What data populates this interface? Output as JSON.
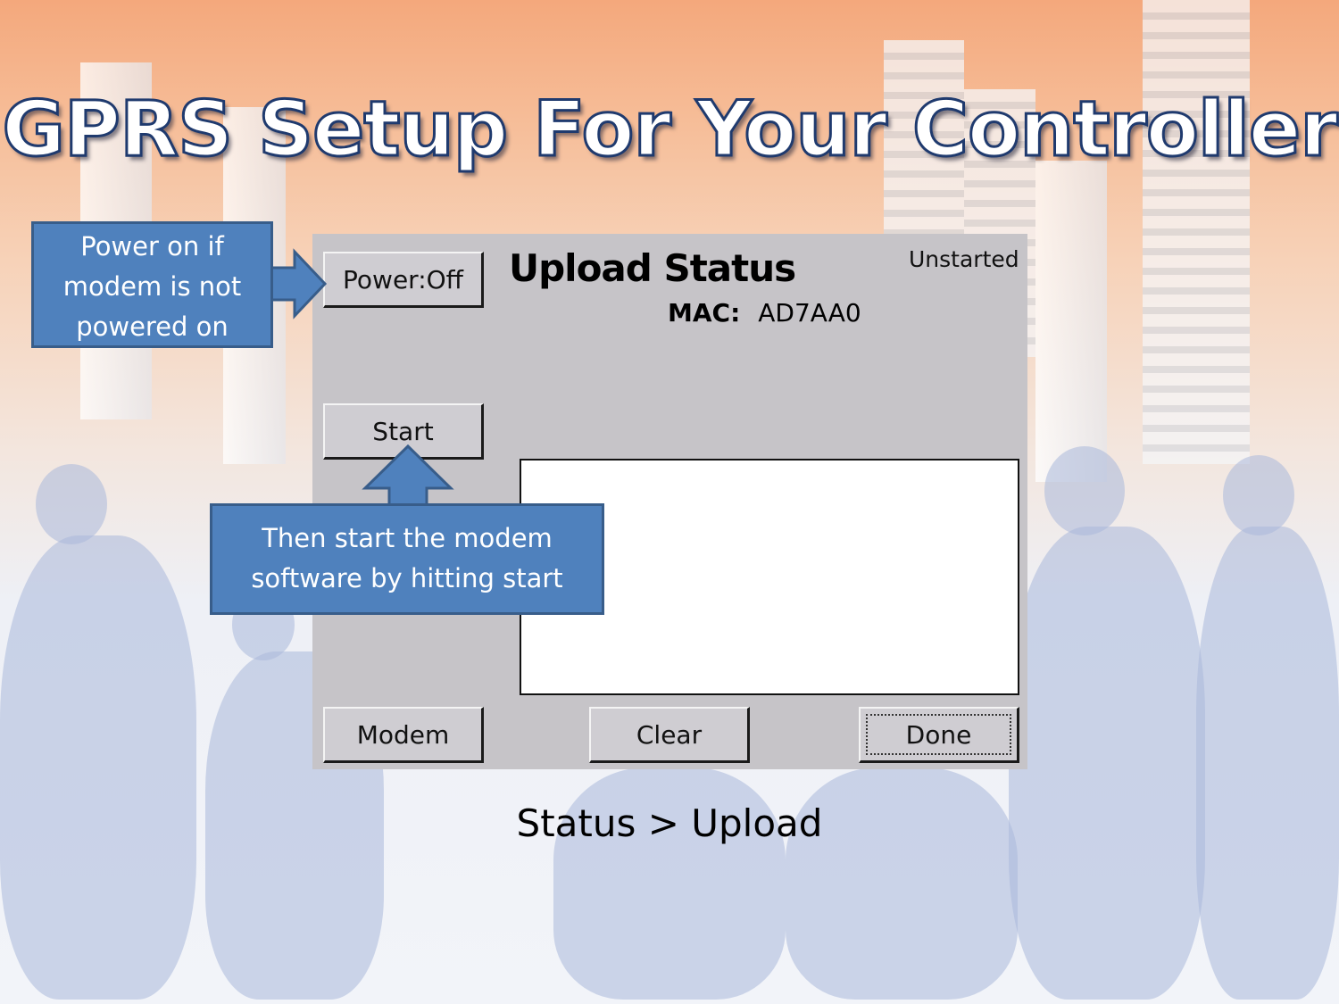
{
  "slide": {
    "title": "GPRS Setup For Your Controller",
    "caption": "Status > Upload"
  },
  "device": {
    "heading": "Upload Status",
    "status_text": "Unstarted",
    "mac_label": "MAC:",
    "mac_value": "AD7AA0",
    "log_content": "",
    "buttons": {
      "power": "Power:Off",
      "start": "Start",
      "modem": "Modem",
      "clear": "Clear",
      "done": "Done"
    }
  },
  "callouts": {
    "power": "Power on if modem is not powered on",
    "start": "Then start the modem software by hitting start"
  },
  "colors": {
    "callout_fill": "#4f81bd",
    "callout_border": "#385d8a",
    "screen_bg": "#c6c4c8"
  }
}
